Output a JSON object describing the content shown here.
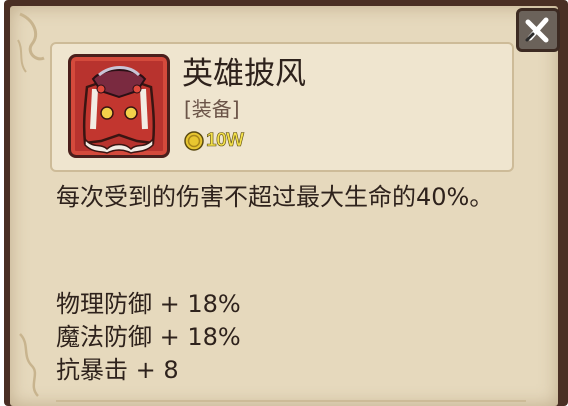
{
  "item": {
    "name": "英雄披风",
    "type_label": "[装备]",
    "price": "10W",
    "icon": "hero-cloak-icon"
  },
  "description": "每次受到的伤害不超过最大生命的40%。",
  "stats": [
    {
      "text": "物理防御 + 18%"
    },
    {
      "text": "魔法防御 + 18%"
    },
    {
      "text": "抗暴击 + 8"
    }
  ],
  "controls": {
    "close_icon": "close-icon"
  },
  "colors": {
    "parchment": "#e6d9bd",
    "frame": "#4a2f24",
    "icon_red": "#b8332e",
    "price_yellow": "#f3e04a",
    "text": "#2e221c"
  }
}
